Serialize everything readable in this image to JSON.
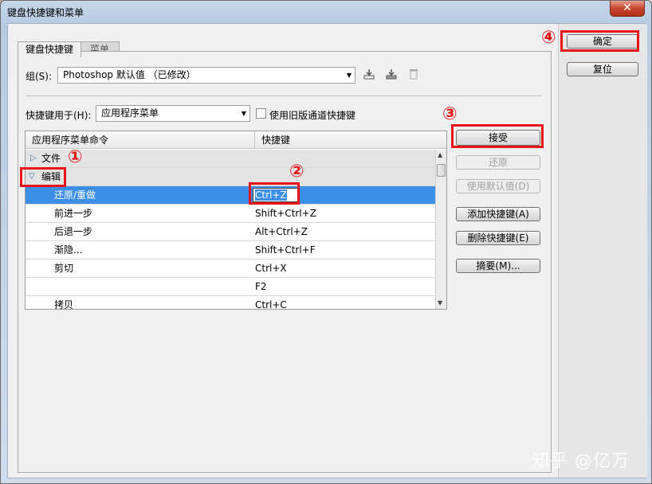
{
  "window": {
    "title": "键盘快捷键和菜单",
    "close_label": "✕"
  },
  "tabs": [
    {
      "label": "键盘快捷键"
    },
    {
      "label": "菜单"
    }
  ],
  "set": {
    "label": "组(S):",
    "value": "Photoshop 默认值 （已修改）"
  },
  "icons": {
    "save_set": "save-set-icon",
    "new_set": "new-set-icon",
    "delete_set": "trash-icon"
  },
  "shortcuts_for": {
    "label": "快捷键用于(H):",
    "value": "应用程序菜单",
    "legacy_checkbox_label": "使用旧版通道快捷键",
    "legacy_checked": false
  },
  "table": {
    "headers": [
      "应用程序菜单命令",
      "快捷键"
    ],
    "rows": [
      {
        "command": "文件",
        "shortcut": "",
        "type": "group",
        "expanded": false
      },
      {
        "command": "编辑",
        "shortcut": "",
        "type": "group",
        "expanded": true
      },
      {
        "command": "还原/重做",
        "shortcut": "Ctrl+Z",
        "type": "item",
        "selected": true
      },
      {
        "command": "前进一步",
        "shortcut": "Shift+Ctrl+Z",
        "type": "item"
      },
      {
        "command": "后退一步",
        "shortcut": "Alt+Ctrl+Z",
        "type": "item"
      },
      {
        "command": "渐隐...",
        "shortcut": "Shift+Ctrl+F",
        "type": "item"
      },
      {
        "command": "剪切",
        "shortcut": "Ctrl+X",
        "type": "item"
      },
      {
        "command": "",
        "shortcut": "F2",
        "type": "item"
      },
      {
        "command": "拷贝",
        "shortcut": "Ctrl+C",
        "type": "item"
      }
    ]
  },
  "actions": {
    "accept": "接受",
    "undo": "还原",
    "use_default": "使用默认值(D)",
    "add": "添加快捷键(A)",
    "delete": "删除快捷键(E)",
    "summarize": "摘要(M)..."
  },
  "dialog": {
    "ok": "确定",
    "reset": "复位"
  },
  "annotations": {
    "n1": "①",
    "n2": "②",
    "n3": "③",
    "n4": "④"
  },
  "watermark": "知乎 @亿万",
  "colors": {
    "highlight": "#e8141a",
    "selection": "#3d8ee6"
  }
}
